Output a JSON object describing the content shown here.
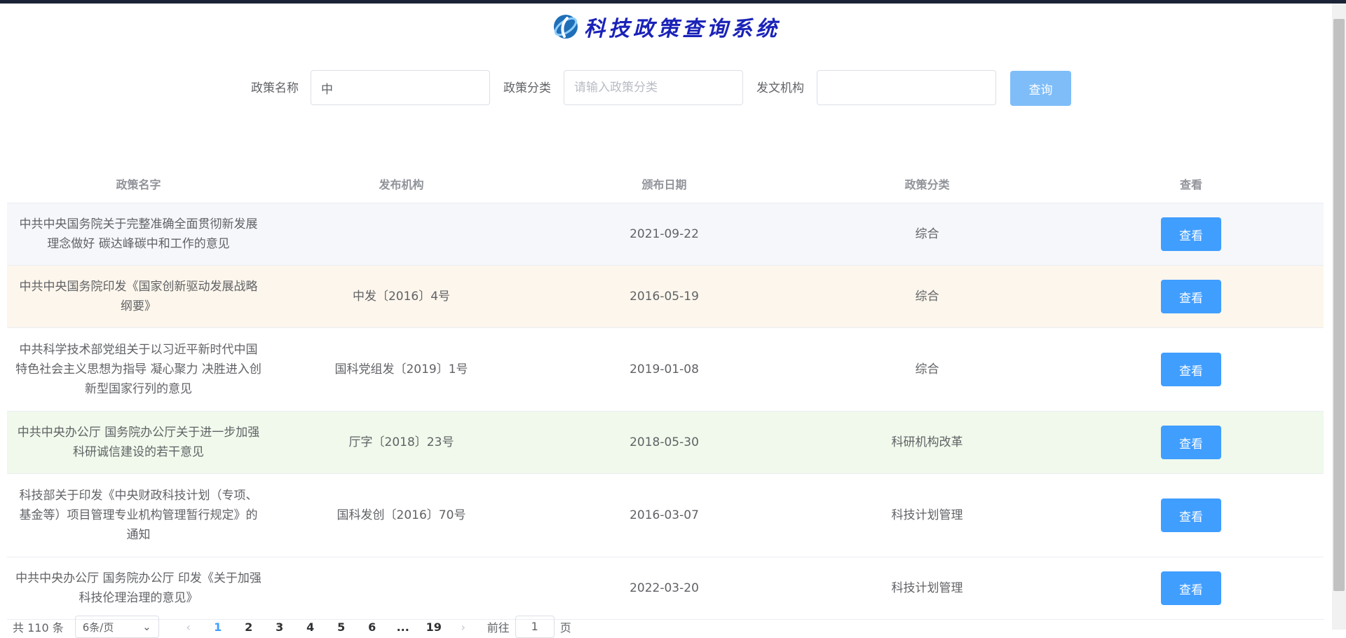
{
  "header": {
    "title": "科技政策查询系统"
  },
  "search": {
    "name_label": "政策名称",
    "name_value": "中",
    "category_label": "政策分类",
    "category_placeholder": "请输入政策分类",
    "org_label": "发文机构",
    "org_value": "",
    "query_label": "查询"
  },
  "table": {
    "columns": [
      "政策名字",
      "发布机构",
      "颁布日期",
      "政策分类",
      "查看"
    ],
    "view_label": "查看",
    "rows": [
      {
        "name": "中共中央国务院关于完整准确全面贯彻新发展理念做好 碳达峰碳中和工作的意见",
        "org": "",
        "date": "2021-09-22",
        "category": "综合",
        "bg": "#f5f7fa"
      },
      {
        "name": "中共中央国务院印发《国家创新驱动发展战略纲要》",
        "org": "中发〔2016〕4号",
        "date": "2016-05-19",
        "category": "综合",
        "bg": "#fdf6ec"
      },
      {
        "name": "中共科学技术部党组关于以习近平新时代中国特色社会主义思想为指导 凝心聚力 决胜进入创新型国家行列的意见",
        "org": "国科党组发〔2019〕1号",
        "date": "2019-01-08",
        "category": "综合",
        "bg": "#ffffff"
      },
      {
        "name": "中共中央办公厅 国务院办公厅关于进一步加强科研诚信建设的若干意见",
        "org": "厅字〔2018〕23号",
        "date": "2018-05-30",
        "category": "科研机构改革",
        "bg": "#f0f9eb"
      },
      {
        "name": "科技部关于印发《中央财政科技计划（专项、基金等）项目管理专业机构管理暂行规定》的通知",
        "org": "国科发创〔2016〕70号",
        "date": "2016-03-07",
        "category": "科技计划管理",
        "bg": "#ffffff"
      },
      {
        "name": "中共中央办公厅 国务院办公厅 印发《关于加强科技伦理治理的意见》",
        "org": "",
        "date": "2022-03-20",
        "category": "科技计划管理",
        "bg": "#ffffff"
      }
    ]
  },
  "pagination": {
    "total": "共 110 条",
    "page_size": "6条/页",
    "prev_icon": "chevron-left-icon",
    "next_icon": "chevron-right-icon",
    "pages": [
      "1",
      "2",
      "3",
      "4",
      "5",
      "6",
      "...",
      "19"
    ],
    "current": "1",
    "goto_label": "前往",
    "goto_value": "1",
    "page_suffix": "页"
  },
  "colors": {
    "primary": "#409eff",
    "primary_light": "#7fbdf8",
    "title": "#1a22b8"
  }
}
